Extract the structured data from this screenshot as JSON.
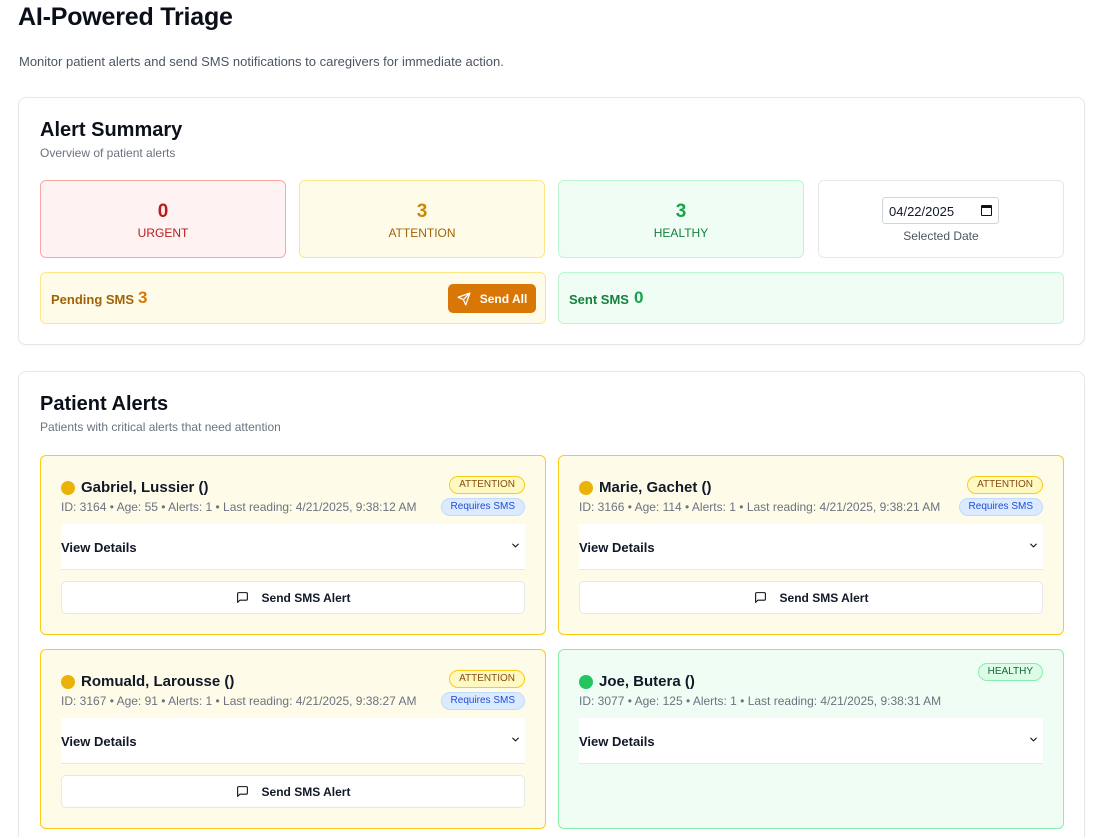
{
  "page": {
    "title": "AI-Powered Triage",
    "subtitle": "Monitor patient alerts and send SMS notifications to caregivers for immediate action."
  },
  "summary": {
    "title": "Alert Summary",
    "description": "Overview of patient alerts",
    "stats": {
      "urgent": {
        "count": "0",
        "label": "URGENT"
      },
      "attention": {
        "count": "3",
        "label": "ATTENTION"
      },
      "healthy": {
        "count": "3",
        "label": "HEALTHY"
      }
    },
    "date": {
      "value": "04/22/2025",
      "label": "Selected Date"
    },
    "pending_sms": {
      "label": "Pending SMS",
      "count": "3",
      "button": "Send All"
    },
    "sent_sms": {
      "label": "Sent SMS",
      "count": "0"
    }
  },
  "alerts": {
    "title": "Patient Alerts",
    "description": "Patients with critical alerts that need attention",
    "details_label": "View Details",
    "sms_button_label": "Send SMS Alert",
    "patients": [
      {
        "name": "Gabriel, Lussier ()",
        "meta": "ID: 3164 • Age: 55 • Alerts: 1 • Last reading: 4/21/2025, 9:38:12 AM",
        "status": "ATTENTION",
        "sms_badge": "Requires SMS"
      },
      {
        "name": "Marie, Gachet ()",
        "meta": "ID: 3166 • Age: 114 • Alerts: 1 • Last reading: 4/21/2025, 9:38:21 AM",
        "status": "ATTENTION",
        "sms_badge": "Requires SMS"
      },
      {
        "name": "Romuald, Larousse ()",
        "meta": "ID: 3167 • Age: 91 • Alerts: 1 • Last reading: 4/21/2025, 9:38:27 AM",
        "status": "ATTENTION",
        "sms_badge": "Requires SMS"
      },
      {
        "name": "Joe, Butera ()",
        "meta": "ID: 3077 • Age: 125 • Alerts: 1 • Last reading: 4/21/2025, 9:38:31 AM",
        "status": "HEALTHY",
        "sms_badge": ""
      }
    ]
  },
  "colors": {
    "urgent": "#b91c1c",
    "attention": "#ca8a04",
    "healthy": "#16a34a",
    "send_all_button": "#d97706"
  },
  "icons": {
    "send_all": "send-icon",
    "sms_button": "message-square-icon",
    "details": "chevron-down-icon",
    "date": "calendar-icon"
  }
}
